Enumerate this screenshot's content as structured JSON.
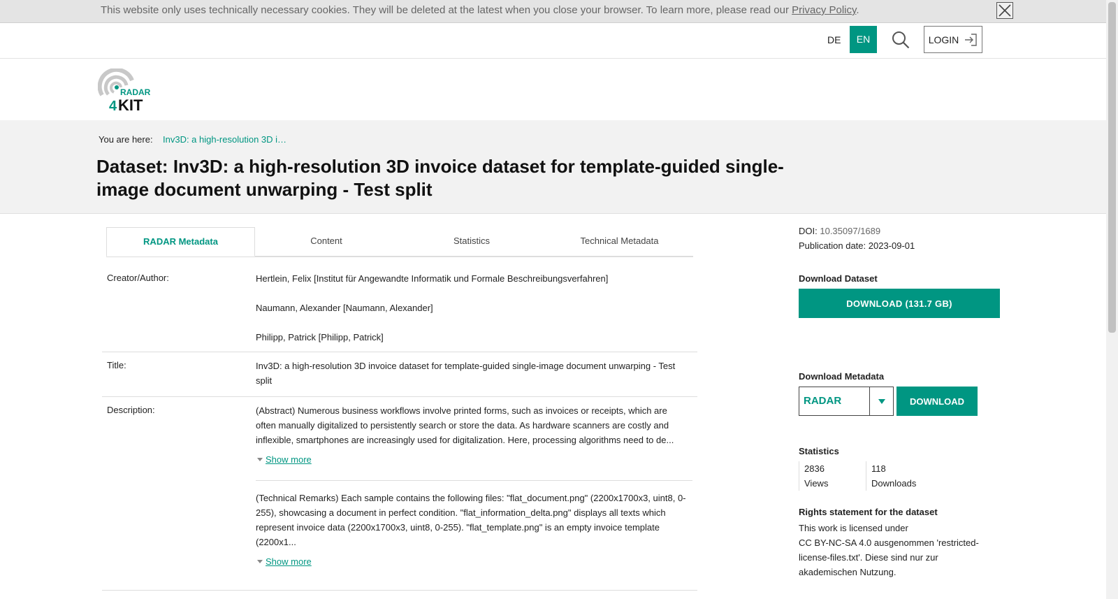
{
  "cookie_banner": {
    "text": "This website only uses technically necessary cookies. They will be deleted at the latest when you close your browser. To learn more, please read our ",
    "link": "Privacy Policy",
    "suffix": "."
  },
  "topbar": {
    "lang_de": "DE",
    "lang_en": "EN",
    "login": "LOGIN"
  },
  "logo": {
    "line1": "RADAR",
    "line2_num": "4",
    "line2_text": "KIT"
  },
  "breadcrumb": {
    "label": "You are here:",
    "current": "Inv3D: a high-resolution 3D i…"
  },
  "page_title": "Dataset: Inv3D: a high-resolution 3D invoice dataset for template-guided single-image document unwarping - Test split",
  "tabs": [
    "RADAR Metadata",
    "Content",
    "Statistics",
    "Technical Metadata"
  ],
  "metadata": {
    "creator_label": "Creator/Author:",
    "creators": [
      "Hertlein, Felix [Institut für Angewandte Informatik und Formale Beschreibungsverfahren]",
      "Naumann, Alexander [Naumann, Alexander]",
      "Philipp, Patrick [Philipp, Patrick]"
    ],
    "title_label": "Title:",
    "title_value": "Inv3D: a high-resolution 3D invoice dataset for template-guided single-image document unwarping - Test split",
    "description_label": "Description:",
    "abstract": "(Abstract) Numerous business workflows involve printed forms, such as invoices or receipts, which are often manually digitalized to persistently search or store the data. As hardware scanners are costly and inflexible, smartphones are increasingly used for digitalization. Here, processing algorithms need to de...",
    "technical_remarks": "(Technical Remarks) Each sample contains the following files: \"flat_document.png\" (2200x1700x3, uint8, 0-255), showcasing a document in perfect condition. \"flat_information_delta.png\" displays all texts which represent invoice data (2200x1700x3, uint8, 0-255). \"flat_template.png\" is an empty invoice template (2200x1...",
    "show_more": "Show more"
  },
  "sidebar": {
    "doi_label": "DOI:",
    "doi_value": "10.35097/1689",
    "pubdate_label": "Publication date:",
    "pubdate_value": "2023-09-01",
    "download_dataset_heading": "Download Dataset",
    "download_dataset_button": "DOWNLOAD (131.7 GB)",
    "download_metadata_heading": "Download Metadata",
    "metadata_format": "RADAR",
    "download_metadata_button": "DOWNLOAD",
    "statistics_heading": "Statistics",
    "views_count": "2836",
    "views_label": "Views",
    "downloads_count": "118",
    "downloads_label": "Downloads",
    "rights_heading": "Rights statement for the dataset",
    "rights_line1": "This work is licensed under",
    "rights_line2": "CC BY-NC-SA 4.0 ausgenommen 'restricted-license-files.txt'. Diese sind nur zur akademischen Nutzung."
  },
  "colors": {
    "accent": "#009682",
    "banner_bg": "#e4e4e4",
    "crumb_bg": "#f2f2f2"
  }
}
